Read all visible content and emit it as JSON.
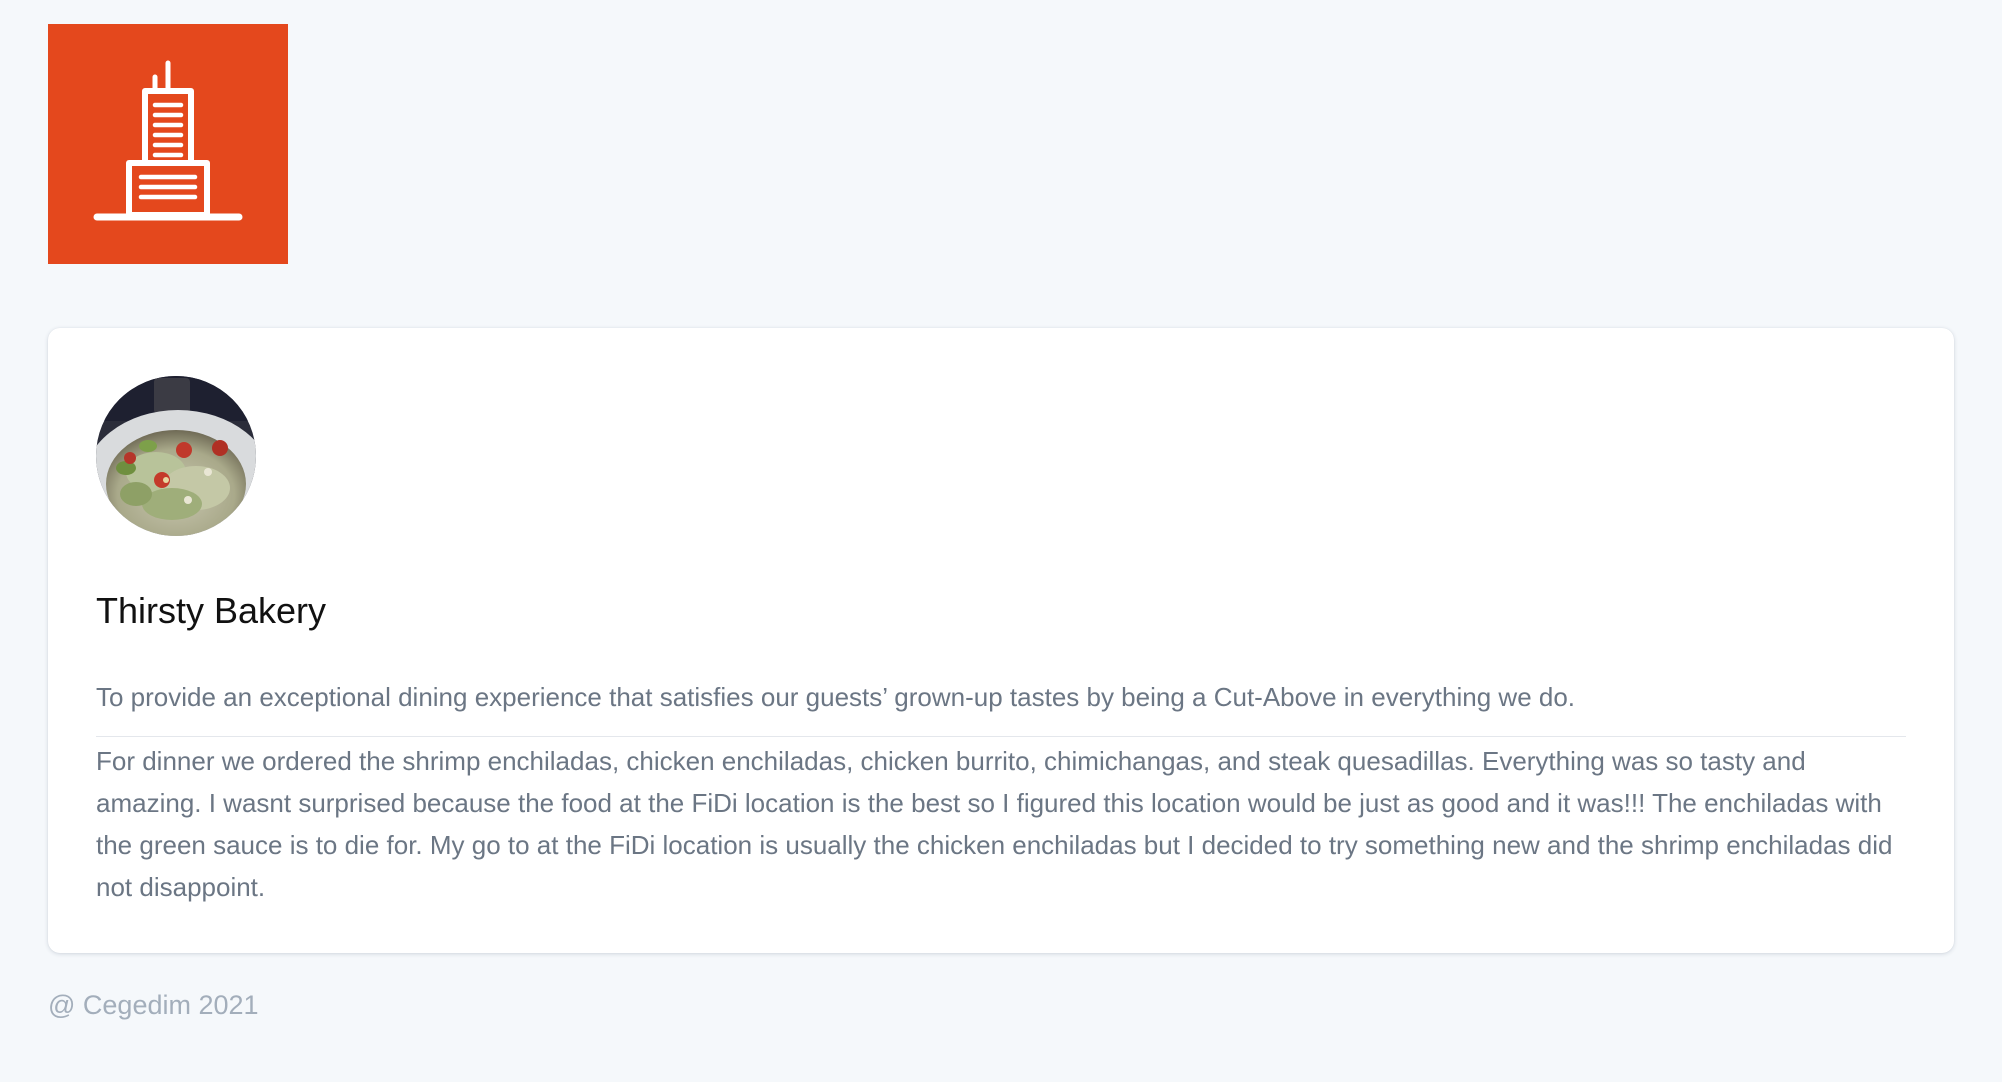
{
  "brand": {
    "logo_icon": "skyscraper-icon",
    "logo_color": "#e4481d"
  },
  "restaurant": {
    "avatar": "salad-photo",
    "name": "Thirsty Bakery",
    "motto": "To provide an exceptional dining experience that satisfies our guests’ grown-up tastes by being a Cut-Above in everything we do.",
    "review": "For dinner we ordered the shrimp enchiladas, chicken enchiladas, chicken burrito, chimichangas, and steak quesadillas. Everything was so tasty and amazing. I wasnt surprised because the food at the FiDi location is the best so I figured this location would be just as good and it was!!! The enchiladas with the green sauce is to die for. My go to at the FiDi location is usually the chicken enchiladas but I decided to try something new and the shrimp enchiladas did not disappoint."
  },
  "footer": {
    "copyright": "@ Cegedim 2021"
  }
}
